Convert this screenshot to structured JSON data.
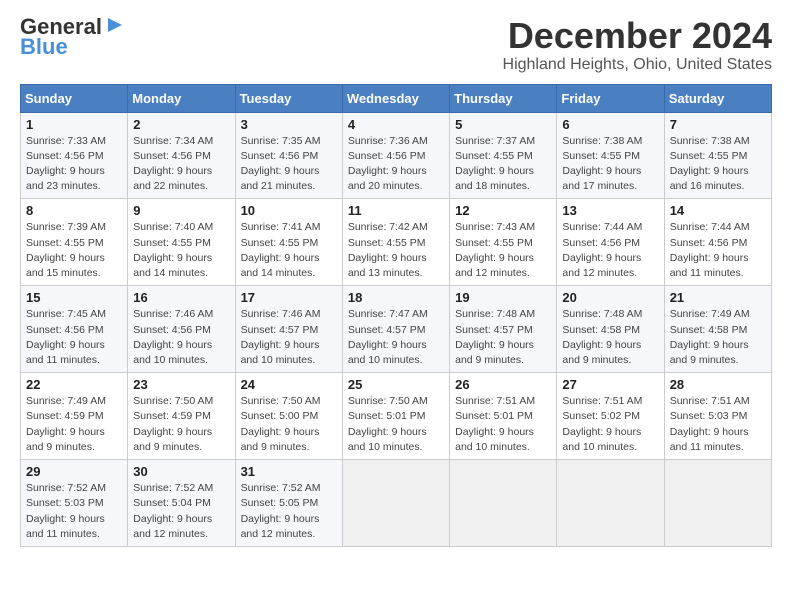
{
  "header": {
    "logo_line1": "General",
    "logo_line2": "Blue",
    "title": "December 2024",
    "subtitle": "Highland Heights, Ohio, United States"
  },
  "days_of_week": [
    "Sunday",
    "Monday",
    "Tuesday",
    "Wednesday",
    "Thursday",
    "Friday",
    "Saturday"
  ],
  "weeks": [
    [
      {
        "day": "1",
        "sunrise": "7:33 AM",
        "sunset": "4:56 PM",
        "daylight": "9 hours and 23 minutes."
      },
      {
        "day": "2",
        "sunrise": "7:34 AM",
        "sunset": "4:56 PM",
        "daylight": "9 hours and 22 minutes."
      },
      {
        "day": "3",
        "sunrise": "7:35 AM",
        "sunset": "4:56 PM",
        "daylight": "9 hours and 21 minutes."
      },
      {
        "day": "4",
        "sunrise": "7:36 AM",
        "sunset": "4:56 PM",
        "daylight": "9 hours and 20 minutes."
      },
      {
        "day": "5",
        "sunrise": "7:37 AM",
        "sunset": "4:55 PM",
        "daylight": "9 hours and 18 minutes."
      },
      {
        "day": "6",
        "sunrise": "7:38 AM",
        "sunset": "4:55 PM",
        "daylight": "9 hours and 17 minutes."
      },
      {
        "day": "7",
        "sunrise": "7:38 AM",
        "sunset": "4:55 PM",
        "daylight": "9 hours and 16 minutes."
      }
    ],
    [
      {
        "day": "8",
        "sunrise": "7:39 AM",
        "sunset": "4:55 PM",
        "daylight": "9 hours and 15 minutes."
      },
      {
        "day": "9",
        "sunrise": "7:40 AM",
        "sunset": "4:55 PM",
        "daylight": "9 hours and 14 minutes."
      },
      {
        "day": "10",
        "sunrise": "7:41 AM",
        "sunset": "4:55 PM",
        "daylight": "9 hours and 14 minutes."
      },
      {
        "day": "11",
        "sunrise": "7:42 AM",
        "sunset": "4:55 PM",
        "daylight": "9 hours and 13 minutes."
      },
      {
        "day": "12",
        "sunrise": "7:43 AM",
        "sunset": "4:55 PM",
        "daylight": "9 hours and 12 minutes."
      },
      {
        "day": "13",
        "sunrise": "7:44 AM",
        "sunset": "4:56 PM",
        "daylight": "9 hours and 12 minutes."
      },
      {
        "day": "14",
        "sunrise": "7:44 AM",
        "sunset": "4:56 PM",
        "daylight": "9 hours and 11 minutes."
      }
    ],
    [
      {
        "day": "15",
        "sunrise": "7:45 AM",
        "sunset": "4:56 PM",
        "daylight": "9 hours and 11 minutes."
      },
      {
        "day": "16",
        "sunrise": "7:46 AM",
        "sunset": "4:56 PM",
        "daylight": "9 hours and 10 minutes."
      },
      {
        "day": "17",
        "sunrise": "7:46 AM",
        "sunset": "4:57 PM",
        "daylight": "9 hours and 10 minutes."
      },
      {
        "day": "18",
        "sunrise": "7:47 AM",
        "sunset": "4:57 PM",
        "daylight": "9 hours and 10 minutes."
      },
      {
        "day": "19",
        "sunrise": "7:48 AM",
        "sunset": "4:57 PM",
        "daylight": "9 hours and 9 minutes."
      },
      {
        "day": "20",
        "sunrise": "7:48 AM",
        "sunset": "4:58 PM",
        "daylight": "9 hours and 9 minutes."
      },
      {
        "day": "21",
        "sunrise": "7:49 AM",
        "sunset": "4:58 PM",
        "daylight": "9 hours and 9 minutes."
      }
    ],
    [
      {
        "day": "22",
        "sunrise": "7:49 AM",
        "sunset": "4:59 PM",
        "daylight": "9 hours and 9 minutes."
      },
      {
        "day": "23",
        "sunrise": "7:50 AM",
        "sunset": "4:59 PM",
        "daylight": "9 hours and 9 minutes."
      },
      {
        "day": "24",
        "sunrise": "7:50 AM",
        "sunset": "5:00 PM",
        "daylight": "9 hours and 9 minutes."
      },
      {
        "day": "25",
        "sunrise": "7:50 AM",
        "sunset": "5:01 PM",
        "daylight": "9 hours and 10 minutes."
      },
      {
        "day": "26",
        "sunrise": "7:51 AM",
        "sunset": "5:01 PM",
        "daylight": "9 hours and 10 minutes."
      },
      {
        "day": "27",
        "sunrise": "7:51 AM",
        "sunset": "5:02 PM",
        "daylight": "9 hours and 10 minutes."
      },
      {
        "day": "28",
        "sunrise": "7:51 AM",
        "sunset": "5:03 PM",
        "daylight": "9 hours and 11 minutes."
      }
    ],
    [
      {
        "day": "29",
        "sunrise": "7:52 AM",
        "sunset": "5:03 PM",
        "daylight": "9 hours and 11 minutes."
      },
      {
        "day": "30",
        "sunrise": "7:52 AM",
        "sunset": "5:04 PM",
        "daylight": "9 hours and 12 minutes."
      },
      {
        "day": "31",
        "sunrise": "7:52 AM",
        "sunset": "5:05 PM",
        "daylight": "9 hours and 12 minutes."
      },
      null,
      null,
      null,
      null
    ]
  ]
}
